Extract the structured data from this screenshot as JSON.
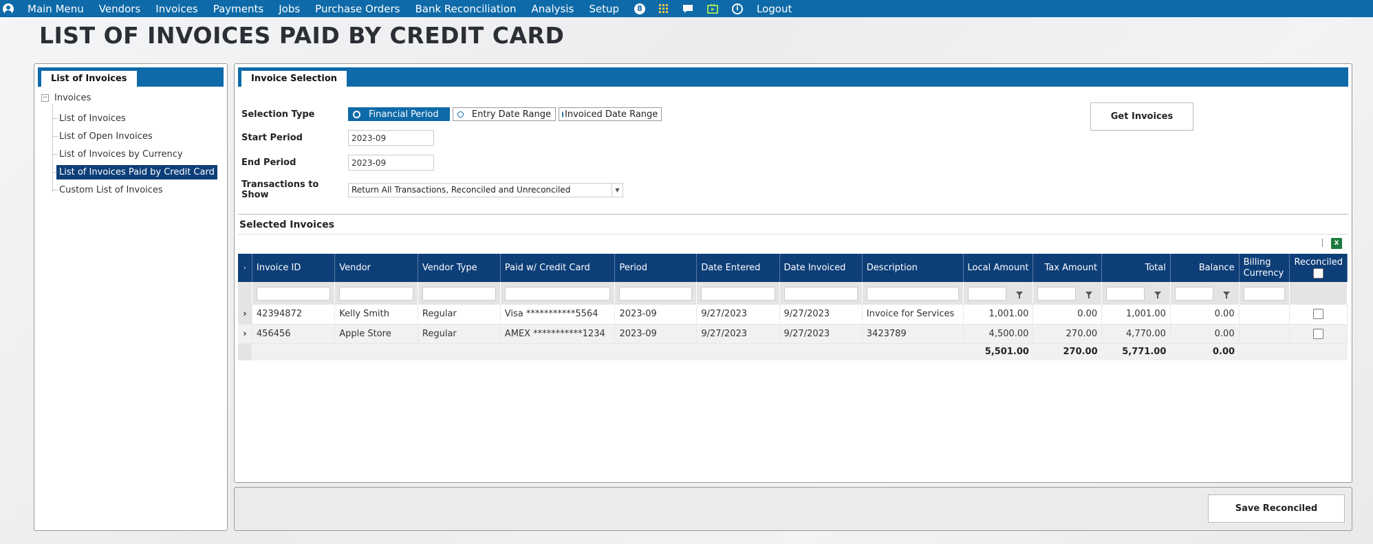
{
  "nav": {
    "items": [
      "Main Menu",
      "Vendors",
      "Invoices",
      "Payments",
      "Jobs",
      "Purchase Orders",
      "Bank Reconciliation",
      "Analysis",
      "Setup"
    ],
    "notification_count": "8",
    "logout": "Logout"
  },
  "page_title": "LIST OF INVOICES PAID BY CREDIT CARD",
  "left_panel": {
    "tab": "List of Invoices",
    "root": "Invoices",
    "items": [
      "List of Invoices",
      "List of Open Invoices",
      "List of Invoices by Currency",
      "List of Invoices Paid by Credit Card",
      "Custom List of Invoices"
    ]
  },
  "right_panel": {
    "tab": "Invoice Selection",
    "selection_type_label": "Selection Type",
    "selection_options": [
      "Financial Period",
      "Entry Date Range",
      "Invoiced Date Range"
    ],
    "start_period_label": "Start Period",
    "start_period": "2023-09",
    "end_period_label": "End Period",
    "end_period": "2023-09",
    "transactions_label": "Transactions to Show",
    "transactions_value": "Return All Transactions, Reconciled and Unreconciled",
    "get_invoices": "Get Invoices",
    "section_title": "Selected Invoices",
    "excel_icon_label": "X"
  },
  "grid": {
    "columns": [
      "Invoice ID",
      "Vendor",
      "Vendor Type",
      "Paid w/ Credit Card",
      "Period",
      "Date Entered",
      "Date Invoiced",
      "Description",
      "Local Amount",
      "Tax Amount",
      "Total",
      "Balance",
      "Billing Currency",
      "Reconciled"
    ],
    "rows": [
      {
        "invoice_id": "42394872",
        "vendor": "Kelly Smith",
        "vendor_type": "Regular",
        "card": "Visa ***********5564",
        "period": "2023-09",
        "date_entered": "9/27/2023",
        "date_invoiced": "9/27/2023",
        "description": "Invoice for Services",
        "local_amount": "1,001.00",
        "tax_amount": "0.00",
        "total": "1,001.00",
        "balance": "0.00",
        "billing_currency": "",
        "reconciled": false
      },
      {
        "invoice_id": "456456",
        "vendor": "Apple Store",
        "vendor_type": "Regular",
        "card": "AMEX ***********1234",
        "period": "2023-09",
        "date_entered": "9/27/2023",
        "date_invoiced": "9/27/2023",
        "description": "3423789",
        "local_amount": "4,500.00",
        "tax_amount": "270.00",
        "total": "4,770.00",
        "balance": "0.00",
        "billing_currency": "",
        "reconciled": false
      }
    ],
    "totals": {
      "local_amount": "5,501.00",
      "tax_amount": "270.00",
      "total": "5,771.00",
      "balance": "0.00"
    }
  },
  "bottom": {
    "save_reconciled": "Save Reconciled"
  }
}
